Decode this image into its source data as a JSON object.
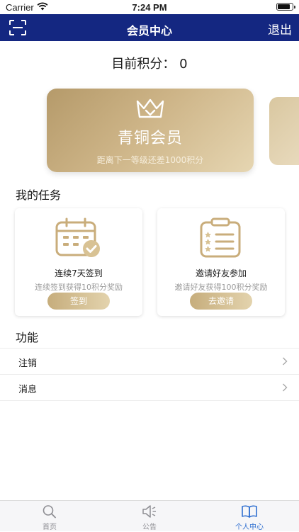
{
  "status_bar": {
    "carrier": "Carrier",
    "time": "7:24 PM",
    "battery_level": 0.85
  },
  "nav": {
    "title": "会员中心",
    "logout_label": "退出"
  },
  "points": {
    "text": "目前积分：  0"
  },
  "membership": {
    "level_name": "青铜会员",
    "tip": "距离下一等级还差1000积分"
  },
  "tasks_section": {
    "title": "我的任务"
  },
  "tasks": [
    {
      "name": "连续7天签到",
      "desc": "连续签到获得10积分奖励",
      "button": "签到"
    },
    {
      "name": "邀请好友参加",
      "desc": "邀请好友获得100积分奖励",
      "button": "去邀请"
    }
  ],
  "functions_section": {
    "title": "功能"
  },
  "functions": [
    {
      "label": "注销"
    },
    {
      "label": "消息"
    }
  ],
  "tab_bar": {
    "items": [
      {
        "label": "首页",
        "icon": "search-icon"
      },
      {
        "label": "公告",
        "icon": "speaker-icon"
      },
      {
        "label": "个人中心",
        "icon": "book-icon"
      }
    ],
    "active_index": 2
  },
  "colors": {
    "nav_bg": "#142781",
    "gold": "#c6ad7c",
    "active_tab": "#2f6fd0"
  }
}
